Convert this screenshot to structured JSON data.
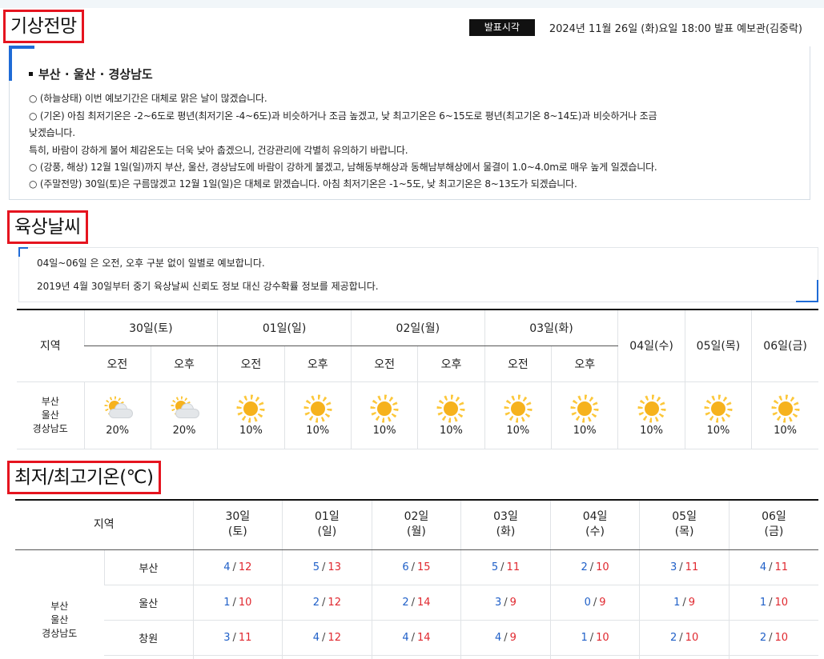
{
  "forecast": {
    "section_title": "기상전망",
    "announce_label": "발표시각",
    "announce_time": "2024년 11월 26일 (화)요일 18:00 발표 예보관(김중락)",
    "region": "부산 · 울산 · 경상남도",
    "lines": [
      "○ (하늘상태) 이번 예보기간은 대체로 맑은 날이 많겠습니다.",
      "○ (기온) 아침 최저기온은 -2~6도로 평년(최저기온 -4~6도)과 비슷하거나 조금 높겠고, 낮 최고기온은 6~15도로 평년(최고기온 8~14도)과 비슷하거나 조금",
      "낮겠습니다.",
      "특히, 바람이 강하게 불어 체감온도는 더욱 낮아 춥겠으니, 건강관리에 각별히 유의하기 바랍니다.",
      "○ (강풍, 해상) 12월 1일(일)까지 부산, 울산, 경상남도에 바람이 강하게 불겠고, 남해동부해상과 동해남부해상에서 물결이 1.0~4.0m로 매우 높게 일겠습니다.",
      "○ (주말전망) 30일(토)은 구름많겠고 12월 1일(일)은 대체로 맑겠습니다. 아침 최저기온은 -1~5도, 낮 최고기온은 8~13도가 되겠습니다."
    ]
  },
  "land": {
    "section_title": "육상날씨",
    "notices": [
      "04일~06일 은 오전, 오후 구분 없이 일별로 예보합니다.",
      "2019년 4월 30일부터 중기 육상날씨 신뢰도 정보 대신 강수확률 정보를 제공합니다."
    ],
    "region_header": "지역",
    "days_split": [
      "30일(토)",
      "01일(일)",
      "02일(월)",
      "03일(화)"
    ],
    "days_single": [
      "04일(수)",
      "05일(목)",
      "06일(금)"
    ],
    "am": "오전",
    "pm": "오후",
    "region_lines": [
      "부산",
      "울산",
      "경상남도"
    ],
    "cells": [
      {
        "icon": "partly-cloudy-icon",
        "pop": "20%"
      },
      {
        "icon": "partly-cloudy-icon",
        "pop": "20%"
      },
      {
        "icon": "sunny-icon",
        "pop": "10%"
      },
      {
        "icon": "sunny-icon",
        "pop": "10%"
      },
      {
        "icon": "sunny-icon",
        "pop": "10%"
      },
      {
        "icon": "sunny-icon",
        "pop": "10%"
      },
      {
        "icon": "sunny-icon",
        "pop": "10%"
      },
      {
        "icon": "sunny-icon",
        "pop": "10%"
      },
      {
        "icon": "sunny-icon",
        "pop": "10%"
      },
      {
        "icon": "sunny-icon",
        "pop": "10%"
      },
      {
        "icon": "sunny-icon",
        "pop": "10%"
      }
    ]
  },
  "temp": {
    "section_title": "최저/최고기온(℃)",
    "region_header": "지역",
    "days": [
      {
        "d": "30일",
        "w": "(토)"
      },
      {
        "d": "01일",
        "w": "(일)"
      },
      {
        "d": "02일",
        "w": "(월)"
      },
      {
        "d": "03일",
        "w": "(화)"
      },
      {
        "d": "04일",
        "w": "(수)"
      },
      {
        "d": "05일",
        "w": "(목)"
      },
      {
        "d": "06일",
        "w": "(금)"
      }
    ],
    "group_lines": [
      "부산",
      "울산",
      "경상남도"
    ],
    "rows": [
      {
        "city": "부산",
        "vals": [
          [
            "4",
            "12"
          ],
          [
            "5",
            "13"
          ],
          [
            "6",
            "15"
          ],
          [
            "5",
            "11"
          ],
          [
            "2",
            "10"
          ],
          [
            "3",
            "11"
          ],
          [
            "4",
            "11"
          ]
        ]
      },
      {
        "city": "울산",
        "vals": [
          [
            "1",
            "10"
          ],
          [
            "2",
            "12"
          ],
          [
            "2",
            "14"
          ],
          [
            "3",
            "9"
          ],
          [
            "0",
            "9"
          ],
          [
            "1",
            "9"
          ],
          [
            "1",
            "10"
          ]
        ]
      },
      {
        "city": "창원",
        "vals": [
          [
            "3",
            "11"
          ],
          [
            "4",
            "12"
          ],
          [
            "4",
            "14"
          ],
          [
            "4",
            "9"
          ],
          [
            "1",
            "10"
          ],
          [
            "2",
            "10"
          ],
          [
            "2",
            "10"
          ]
        ]
      }
    ],
    "colors": {
      "low": "#2060c8",
      "high": "#e0282f"
    }
  }
}
